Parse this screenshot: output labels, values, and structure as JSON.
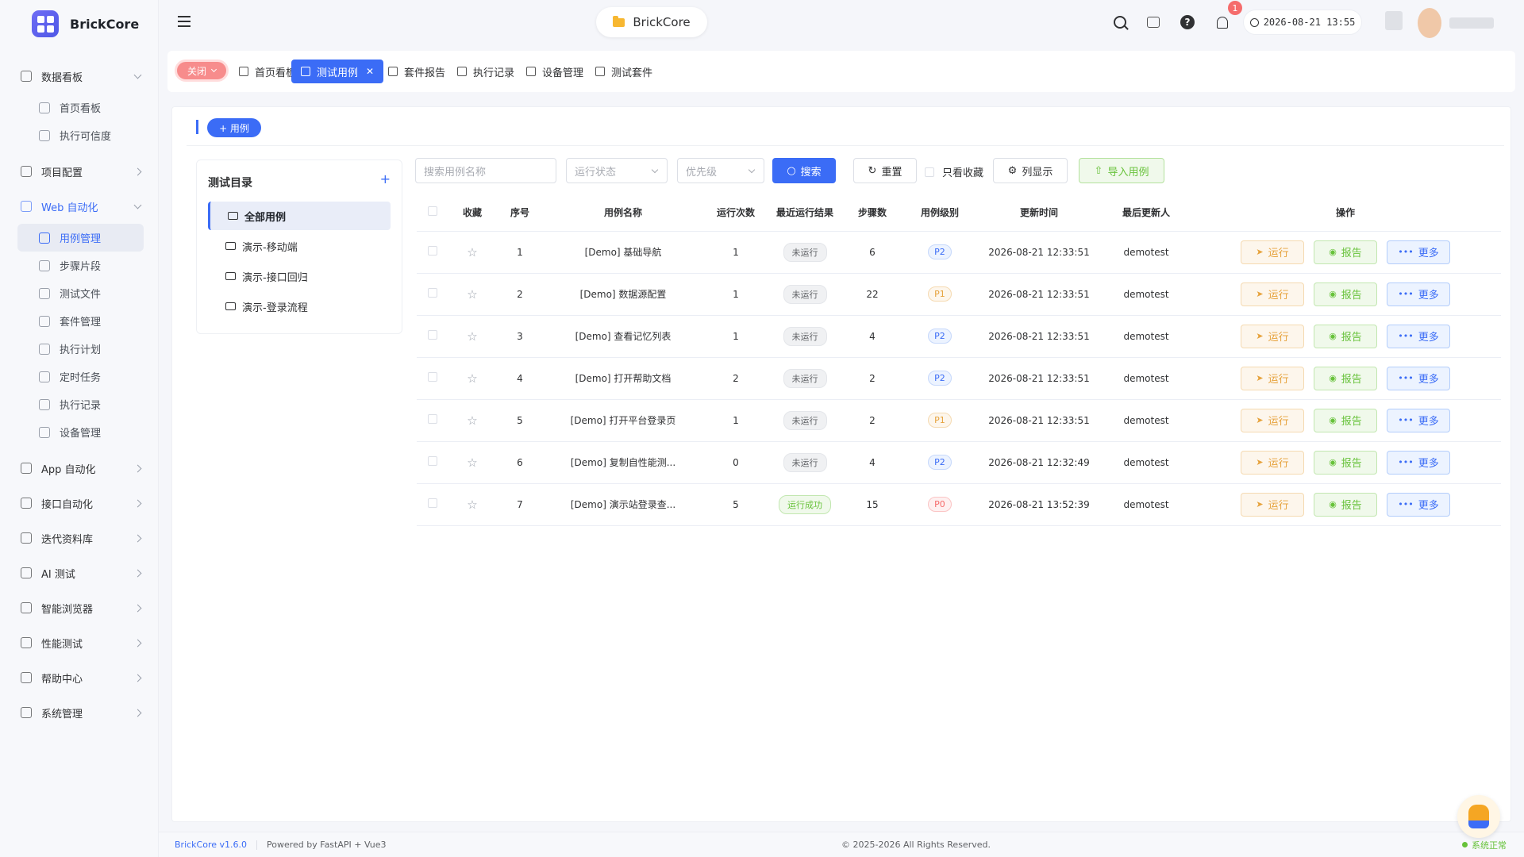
{
  "app": {
    "brand": "BrickCore",
    "project": "BrickCore",
    "datetime": "2026-08-21 13:55",
    "notifications": "1"
  },
  "sidebar": {
    "groups": [
      {
        "label": "数据看板",
        "icon": "dashboard-icon",
        "expanded": true,
        "items": [
          {
            "label": "首页看板",
            "icon": "gauge-icon"
          },
          {
            "label": "执行可信度",
            "icon": "chart-icon"
          }
        ]
      },
      {
        "label": "项目配置",
        "icon": "config-icon"
      },
      {
        "label": "Web 自动化",
        "icon": "web-icon",
        "expanded": true,
        "active": true,
        "items": [
          {
            "label": "用例管理",
            "icon": "document-icon",
            "active": true
          },
          {
            "label": "步骤片段",
            "icon": "snippet-icon"
          },
          {
            "label": "测试文件",
            "icon": "folder-icon"
          },
          {
            "label": "套件管理",
            "icon": "suite-icon"
          },
          {
            "label": "执行计划",
            "icon": "calendar-icon"
          },
          {
            "label": "定时任务",
            "icon": "clock-icon"
          },
          {
            "label": "执行记录",
            "icon": "record-icon"
          },
          {
            "label": "设备管理",
            "icon": "monitor-icon"
          }
        ]
      },
      {
        "label": "App 自动化",
        "icon": "mobile-icon"
      },
      {
        "label": "接口自动化",
        "icon": "api-icon"
      },
      {
        "label": "迭代资料库",
        "icon": "library-icon"
      },
      {
        "label": "AI 测试",
        "icon": "ai-icon"
      },
      {
        "label": "智能浏览器",
        "icon": "browser-icon"
      },
      {
        "label": "性能测试",
        "icon": "performance-icon"
      },
      {
        "label": "帮助中心",
        "icon": "book-icon"
      },
      {
        "label": "系统管理",
        "icon": "gear-icon"
      }
    ]
  },
  "tabs": {
    "close_label": "关闭",
    "items": [
      {
        "label": "首页看板"
      },
      {
        "label": "测试用例",
        "active": true
      },
      {
        "label": "套件报告"
      },
      {
        "label": "执行记录"
      },
      {
        "label": "设备管理"
      },
      {
        "label": "测试套件"
      }
    ]
  },
  "toolbar": {
    "add_label": "+ 用例"
  },
  "tree": {
    "title": "测试目录",
    "items": [
      {
        "label": "全部用例",
        "active": true
      },
      {
        "label": "演示-移动端"
      },
      {
        "label": "演示-接口回归"
      },
      {
        "label": "演示-登录流程"
      }
    ]
  },
  "filters": {
    "search_placeholder": "搜索用例名称",
    "status_placeholder": "运行状态",
    "priority_placeholder": "优先级",
    "search_label": "搜索",
    "reset_label": "重置",
    "fav_only_label": "只看收藏",
    "columns_label": "列显示",
    "import_label": "导入用例"
  },
  "table": {
    "headers": [
      "收藏",
      "序号",
      "用例名称",
      "运行次数",
      "最近运行结果",
      "步骤数",
      "用例级别",
      "更新时间",
      "最后更新人",
      "操作"
    ],
    "run_label": "运行",
    "report_label": "报告",
    "more_label": "更多",
    "rows": [
      {
        "no": "1",
        "name": "[Demo] 基础导航",
        "runs": "1",
        "result": "未运行",
        "steps": "6",
        "level": "P2",
        "updated": "2026-08-21 12:33:51",
        "user": "demotest"
      },
      {
        "no": "2",
        "name": "[Demo] 数据源配置",
        "runs": "1",
        "result": "未运行",
        "steps": "22",
        "level": "P1",
        "updated": "2026-08-21 12:33:51",
        "user": "demotest"
      },
      {
        "no": "3",
        "name": "[Demo] 查看记忆列表",
        "runs": "1",
        "result": "未运行",
        "steps": "4",
        "level": "P2",
        "updated": "2026-08-21 12:33:51",
        "user": "demotest"
      },
      {
        "no": "4",
        "name": "[Demo] 打开帮助文档",
        "runs": "2",
        "result": "未运行",
        "steps": "2",
        "level": "P2",
        "updated": "2026-08-21 12:33:51",
        "user": "demotest"
      },
      {
        "no": "5",
        "name": "[Demo] 打开平台登录页",
        "runs": "1",
        "result": "未运行",
        "steps": "2",
        "level": "P1",
        "updated": "2026-08-21 12:33:51",
        "user": "demotest"
      },
      {
        "no": "6",
        "name": "[Demo] 复制自性能测...",
        "runs": "0",
        "result": "未运行",
        "steps": "4",
        "level": "P2",
        "updated": "2026-08-21 12:32:49",
        "user": "demotest"
      },
      {
        "no": "7",
        "name": "[Demo] 演示站登录查...",
        "runs": "5",
        "result": "运行成功",
        "steps": "15",
        "level": "P0",
        "updated": "2026-08-21 13:52:39",
        "user": "demotest"
      }
    ]
  },
  "footer": {
    "version": "BrickCore v1.6.0",
    "powered": "Powered by FastAPI + Vue3",
    "copyright": "© 2025-2026 All Rights Reserved.",
    "status": "系统正常"
  },
  "colors": {
    "primary": "#3b6cf6",
    "success": "#67c23a",
    "warning": "#e6a23c",
    "danger": "#f56c6c"
  }
}
